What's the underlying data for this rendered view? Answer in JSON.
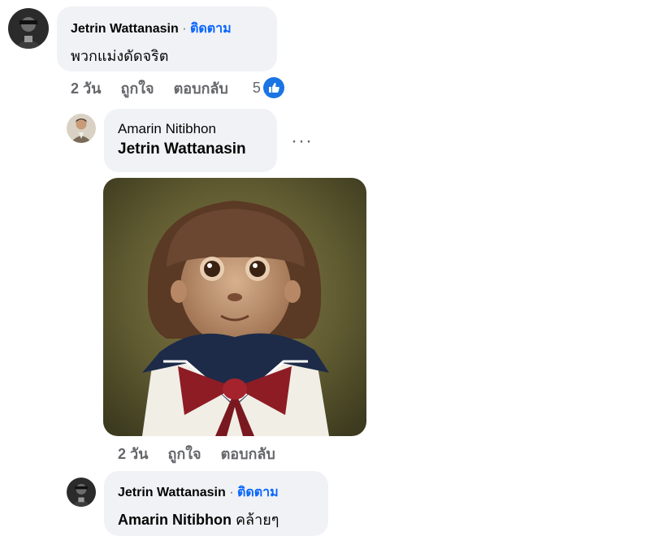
{
  "comments": [
    {
      "author": "Jetrin Wattanasin",
      "separator": "·",
      "follow_label": "ติดตาม",
      "text": "พวกแม่งดัดจริต",
      "time": "2 วัน",
      "like_label": "ถูกใจ",
      "reply_label": "ตอบกลับ",
      "reaction_count": "5",
      "reaction_icon": "like-icon"
    },
    {
      "author": "Amarin Nitibhon",
      "tag": "Jetrin Wattanasin",
      "more_label": "···",
      "image_description": "monkey-in-sailor-uniform-photo",
      "time": "2 วัน",
      "like_label": "ถูกใจ",
      "reply_label": "ตอบกลับ"
    },
    {
      "author": "Jetrin Wattanasin",
      "separator": "·",
      "follow_label": "ติดตาม",
      "tag": "Amarin Nitibhon",
      "text": "คล้ายๆ"
    }
  ],
  "colors": {
    "bubble": "#f0f2f5",
    "follow": "#0866ff",
    "like": "#1b74e4",
    "muted": "#65676b"
  }
}
